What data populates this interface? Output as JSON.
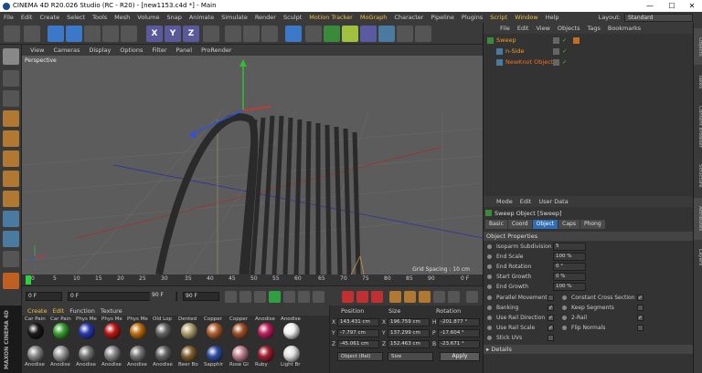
{
  "titlebar": {
    "title": "CINEMA 4D R20.026 Studio (RC - R20) - [new1153.c4d *] - Main",
    "minimize": "—",
    "maximize": "☐",
    "close": "✕"
  },
  "menu": [
    "File",
    "Edit",
    "Create",
    "Select",
    "Tools",
    "Mesh",
    "Volume",
    "Snap",
    "Animate",
    "Simulate",
    "Render",
    "Sculpt",
    "Motion Tracker",
    "MoGraph",
    "Character",
    "Pipeline",
    "Plugins",
    "Script",
    "Window",
    "Help"
  ],
  "layout": {
    "label": "Layout:",
    "value": "Standard"
  },
  "toolbar_axes": [
    "X",
    "Y",
    "Z"
  ],
  "viewport": {
    "menu": [
      "View",
      "Cameras",
      "Display",
      "Options",
      "Filter",
      "Panel",
      "ProRender"
    ],
    "label": "Perspective",
    "grid_spacing": "Grid Spacing : 10 cm"
  },
  "timeline": {
    "ticks": [
      "0",
      "5",
      "10",
      "15",
      "20",
      "25",
      "30",
      "35",
      "40",
      "45",
      "50",
      "55",
      "60",
      "65",
      "70",
      "75",
      "80",
      "85",
      "90"
    ],
    "end_label": "0 F",
    "start_frame": "0 F",
    "current_frame": "0 F",
    "end_frame": "90 F",
    "max_frame": "90 F"
  },
  "materials": {
    "menu": [
      "Create",
      "Edit",
      "Function",
      "Texture"
    ],
    "row1": [
      {
        "label": "Car Pain",
        "color": "#1a1a1a"
      },
      {
        "label": "Car Pain",
        "color": "#3aa030"
      },
      {
        "label": "Phys Me",
        "color": "#2a3ab0"
      },
      {
        "label": "Phys Me",
        "color": "#c01818"
      },
      {
        "label": "Phys Me",
        "color": "#c07010"
      },
      {
        "label": "Old Lop",
        "color": "#666666"
      },
      {
        "label": "Dented",
        "color": "#b0a070"
      },
      {
        "label": "Copper",
        "color": "#b06030"
      },
      {
        "label": "Copper",
        "color": "#a05028"
      },
      {
        "label": "Anodise",
        "color": "#c02060"
      },
      {
        "label": "Anodise",
        "color": "#f0f0f0"
      }
    ],
    "row2": [
      {
        "label": "Anodise",
        "color": "#888888"
      },
      {
        "label": "Anodise",
        "color": "#999999"
      },
      {
        "label": "Anodise",
        "color": "#777777"
      },
      {
        "label": "Anodise",
        "color": "#888888"
      },
      {
        "label": "Anodise",
        "color": "#777777"
      },
      {
        "label": "Anodise",
        "color": "#666666"
      },
      {
        "label": "Beer Bo",
        "color": "#806030"
      },
      {
        "label": "Sapphir",
        "color": "#3050a0"
      },
      {
        "label": "Rose Gl",
        "color": "#c08090"
      },
      {
        "label": "Ruby",
        "color": "#a02030"
      },
      {
        "label": "Light Br",
        "color": "#e0e0e0"
      }
    ]
  },
  "coords": {
    "headers": {
      "position": "Position",
      "size": "Size",
      "rotation": "Rotation"
    },
    "rows": [
      {
        "axis": "X",
        "pos": "143.431 cm",
        "size_axis": "X",
        "size": "196.759 cm",
        "rot_axis": "H",
        "rot": "-201.877 °"
      },
      {
        "axis": "Y",
        "pos": "-7.797 cm",
        "size_axis": "Y",
        "size": "137.299 cm",
        "rot_axis": "P",
        "rot": "-17.604 °"
      },
      {
        "axis": "Z",
        "pos": "-45.061 cm",
        "size_axis": "Z",
        "size": "152.463 cm",
        "rot_axis": "B",
        "rot": "-23.671 °"
      }
    ],
    "mode": "Object (Rel)",
    "size_mode": "Size",
    "apply": "Apply"
  },
  "objects": {
    "menu": [
      "File",
      "Edit",
      "View",
      "Objects",
      "Tags",
      "Bookmarks"
    ],
    "items": [
      {
        "name": "Sweep",
        "indent": 0,
        "color": "#f0a020"
      },
      {
        "name": "n-Side",
        "indent": 1,
        "color": "#f0a020"
      },
      {
        "name": "NewKnot Object",
        "indent": 1,
        "color": "#f07020"
      }
    ]
  },
  "attributes": {
    "menu": [
      "Mode",
      "Edit",
      "User Data"
    ],
    "title": "Sweep Object [Sweep]",
    "tabs": [
      "Basic",
      "Coord",
      "Object",
      "Caps",
      "Phong"
    ],
    "active_tab": "Object",
    "section": "Object Properties",
    "props": [
      {
        "label": "Isoparm Subdivision",
        "value": "5"
      },
      {
        "label": "End Scale",
        "value": "100 %"
      },
      {
        "label": "End Rotation",
        "value": "0 °"
      },
      {
        "label": "Start Growth",
        "value": "0 %"
      },
      {
        "label": "End Growth",
        "value": "100 %"
      }
    ],
    "checks_left": [
      {
        "label": "Parallel Movement",
        "checked": false
      },
      {
        "label": "Banking",
        "checked": true
      },
      {
        "label": "Use Rail Direction",
        "checked": true
      },
      {
        "label": "Use Rail Scale",
        "checked": true
      },
      {
        "label": "Stick UVs",
        "checked": false
      }
    ],
    "checks_right": [
      {
        "label": "Constant Cross Section",
        "checked": true
      },
      {
        "label": "Keep Segments",
        "checked": false
      },
      {
        "label": "2-Rail",
        "checked": true
      },
      {
        "label": "Flip Normals",
        "checked": false
      }
    ],
    "details": "Details"
  },
  "side_tabs": [
    "Objects",
    "Takes",
    "Content Browser",
    "Structure",
    "Attributes",
    "Layers"
  ],
  "brand": "MAXON CINEMA 4D"
}
